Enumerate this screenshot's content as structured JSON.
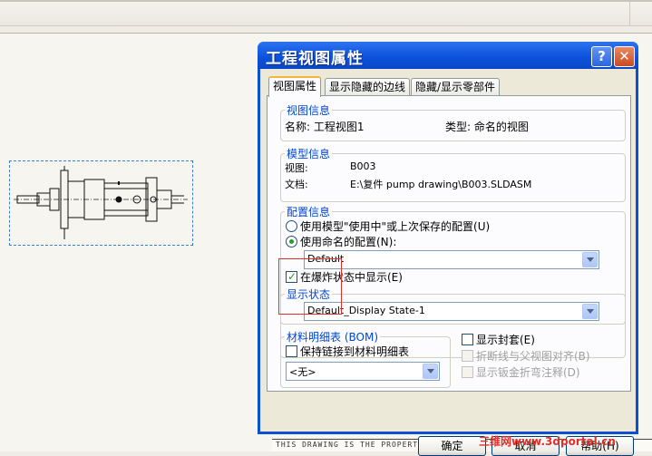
{
  "dialog": {
    "title": "工程视图属性",
    "help_button": "?",
    "close_button": "✕",
    "tabs": [
      "视图属性",
      "显示隐藏的边线",
      "隐藏/显示零部件"
    ],
    "view_info": {
      "label": "视图信息",
      "name_label": "名称: 工程视图1",
      "type_label": "类型: 命名的视图"
    },
    "model_info": {
      "label": "模型信息",
      "view_key": "视图:",
      "view_value": "B003",
      "doc_key": "文档:",
      "doc_value": "E:\\复件 pump drawing\\B003.SLDASM"
    },
    "config_info": {
      "label": "配置信息",
      "radio_model": "使用模型\"使用中\"或上次保存的配置(U)",
      "radio_named": "使用命名的配置(N):",
      "config_value": "Default",
      "exploded_check": "在爆炸状态中显示(E)"
    },
    "display_state": {
      "label": "显示状态",
      "value": "Default_Display State-1"
    },
    "bom": {
      "label": "材料明细表 (BOM)",
      "keep_link": "保持链接到材料明细表",
      "value": "<无>"
    },
    "options": {
      "show_envelope": "显示封套(E)",
      "broken_align": "折断线与父视图对齐(B)",
      "sheet_metal_notes": "显示钣金折弯注释(D)"
    },
    "buttons": {
      "ok": "确定",
      "cancel": "取消",
      "help": "帮助(H)"
    }
  },
  "watermark": "三维网www.3dportal.cn",
  "title_block_text": "THIS DRAWING IS THE PROPERTY OF ..."
}
